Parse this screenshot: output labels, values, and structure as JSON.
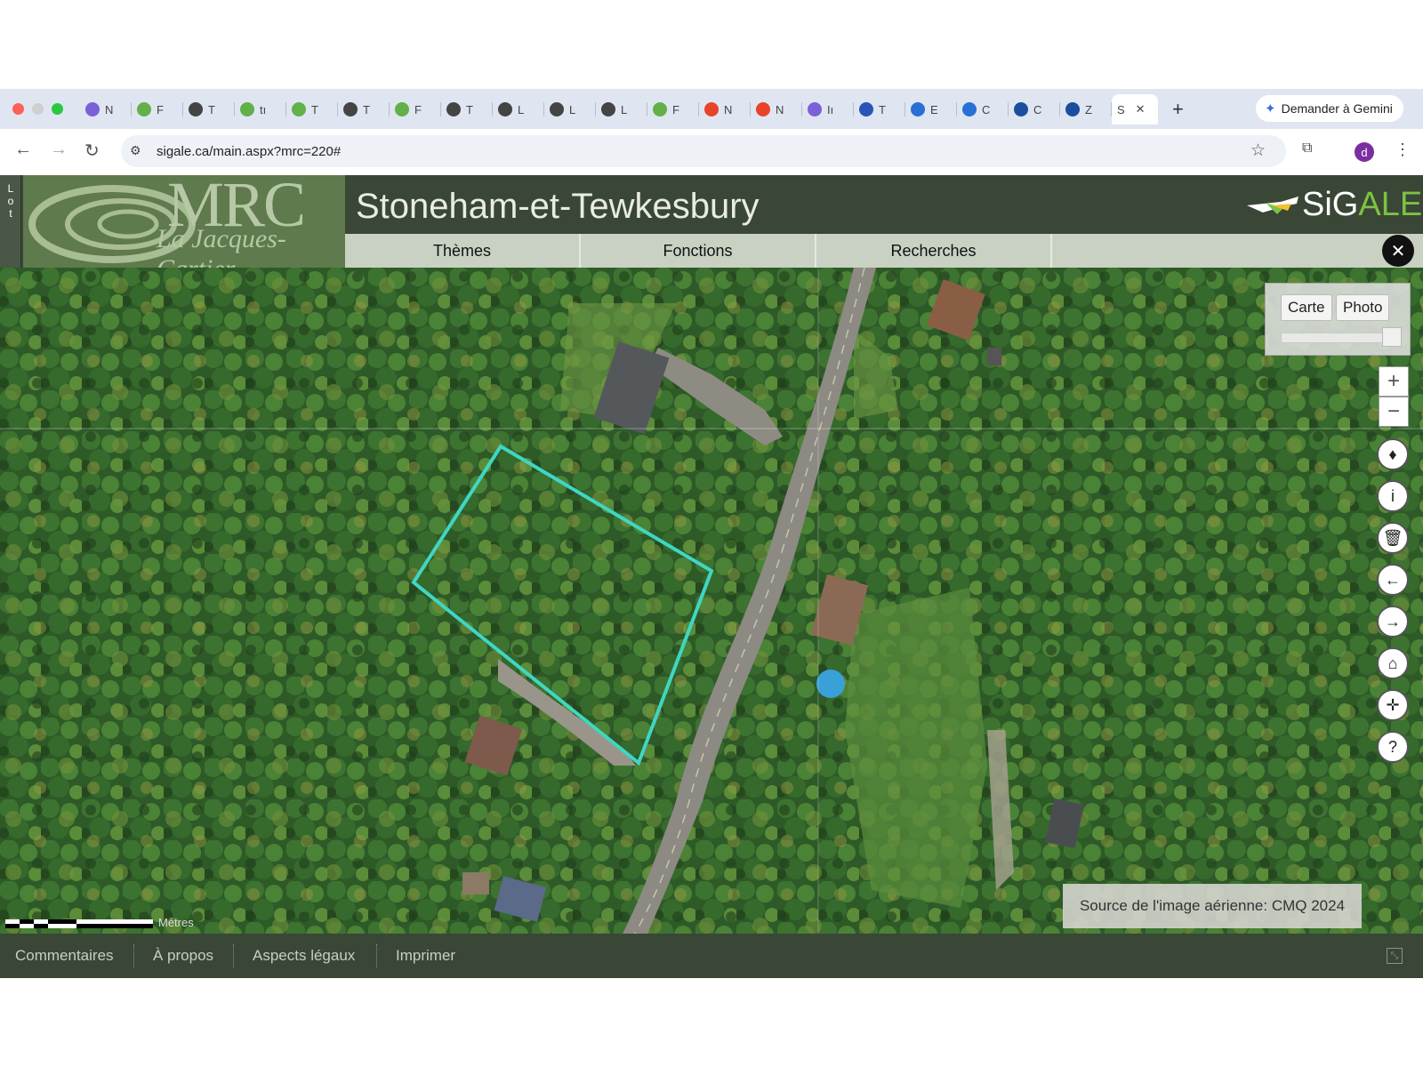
{
  "browser": {
    "tabs": [
      {
        "letter": "N",
        "icon": "pinwheel-icon",
        "color": "#7b61d8"
      },
      {
        "letter": "F",
        "icon": "leaf-icon",
        "color": "#62b04a"
      },
      {
        "letter": "T",
        "icon": "globe-icon",
        "color": "#444444"
      },
      {
        "letter": "tı",
        "icon": "leaf-icon",
        "color": "#62b04a"
      },
      {
        "letter": "T",
        "icon": "leaf-icon",
        "color": "#62b04a"
      },
      {
        "letter": "T",
        "icon": "globe-icon",
        "color": "#444444"
      },
      {
        "letter": "F",
        "icon": "leaf-icon",
        "color": "#62b04a"
      },
      {
        "letter": "T",
        "icon": "globe-icon",
        "color": "#444444"
      },
      {
        "letter": "L",
        "icon": "globe-icon",
        "color": "#444444"
      },
      {
        "letter": "L",
        "icon": "globe-icon",
        "color": "#444444"
      },
      {
        "letter": "L",
        "icon": "globe-icon",
        "color": "#444444"
      },
      {
        "letter": "F",
        "icon": "leaf-icon",
        "color": "#62b04a"
      },
      {
        "letter": "N",
        "icon": "c-logo-icon",
        "color": "#e8432a"
      },
      {
        "letter": "N",
        "icon": "c-logo-icon",
        "color": "#e8432a"
      },
      {
        "letter": "Iı",
        "icon": "pinwheel-icon",
        "color": "#7b61d8"
      },
      {
        "letter": "T",
        "icon": "target-icon",
        "color": "#2a55b8"
      },
      {
        "letter": "E",
        "icon": "mail-icon",
        "color": "#2a6fd6"
      },
      {
        "letter": "C",
        "icon": "mail-icon",
        "color": "#2a6fd6"
      },
      {
        "letter": "C",
        "icon": "fleur-de-lis-icon",
        "color": "#1c4ea0"
      },
      {
        "letter": "Z",
        "icon": "fleur-de-lis-icon",
        "color": "#1c4ea0"
      }
    ],
    "active_tab_letter": "S",
    "active_tab_close": "✕",
    "new_tab": "+",
    "gemini_label": "Demander à Gemini",
    "url": "sigale.ca/main.aspx?mrc=220#",
    "back": "←",
    "forward": "→",
    "reload": "↻",
    "star": "☆",
    "profile_letter": "d",
    "menu": "⋮",
    "lens": "⧉",
    "site_settings": "⚙"
  },
  "app": {
    "lot_tab": "Lot",
    "logo_mrc": "MRC",
    "logo_subtitle": "La Jacques-Cartier",
    "title": "Stoneham-et-Tewkesbury",
    "brand_si": "SiG",
    "brand_ale": "ALE",
    "menu": [
      "Thèmes",
      "Fonctions",
      "Recherches"
    ],
    "close": "✕"
  },
  "map": {
    "layers": [
      "Carte",
      "Photo"
    ],
    "zoom_in": "+",
    "zoom_out": "−",
    "tools": [
      {
        "icon": "compass-icon",
        "glyph": "♦"
      },
      {
        "icon": "info-icon",
        "glyph": "i"
      },
      {
        "icon": "trash-icon",
        "glyph": "🗑"
      },
      {
        "icon": "back-arrow-icon",
        "glyph": "←"
      },
      {
        "icon": "forward-arrow-icon",
        "glyph": "→"
      },
      {
        "icon": "home-icon",
        "glyph": "⌂"
      },
      {
        "icon": "locate-icon",
        "glyph": "✛"
      },
      {
        "icon": "help-icon",
        "glyph": "?"
      }
    ],
    "source_text": "Source de l'image aérienne: CMQ 2024",
    "scale_label": "Mètres",
    "parcel_color": "#3fd6c4"
  },
  "footer": {
    "links": [
      "Commentaires",
      "À propos",
      "Aspects légaux",
      "Imprimer"
    ]
  }
}
